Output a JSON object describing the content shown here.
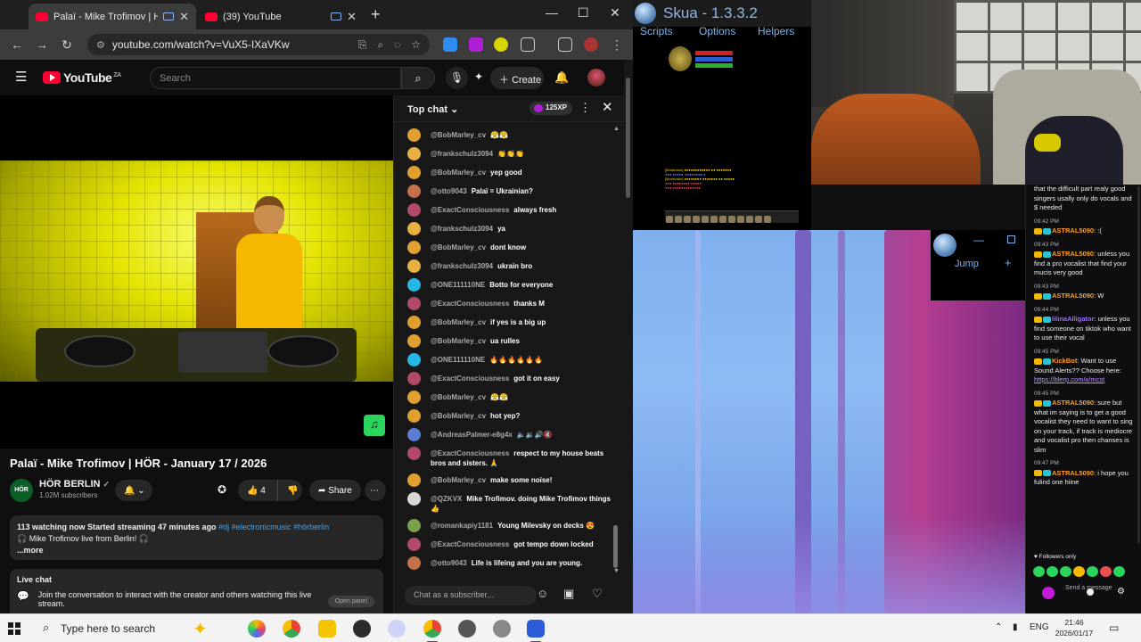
{
  "browser": {
    "tabs": [
      {
        "title": "Palaï - Mike Trofimov | HÖR",
        "active": true
      },
      {
        "title": "(39) YouTube",
        "active": false
      }
    ],
    "url": "youtube.com/watch?v=VuX5-IXaVKw"
  },
  "youtube": {
    "logo_text": "YouTube",
    "country": "ZA",
    "search_placeholder": "Search",
    "create_label": "Create",
    "video_title": "Palaï - Mike Trofimov | HÖR - January 17 / 2026",
    "channel": {
      "avatar_text": "HÖR",
      "name": "HÖR BERLIN",
      "verified": "✓",
      "subscribers": "1.02M subscribers"
    },
    "like_count": "4",
    "share_label": "Share",
    "description": {
      "stats": "113 watching now  Started streaming 47 minutes ago",
      "tags": "#dj #electronicmusic #hörberlin",
      "line2": "🎧 Mike Trofimov live from Berlin! 🎧",
      "more": "...more"
    },
    "live_chat_box": {
      "title": "Live chat",
      "text": "Join the conversation to interact with the creator and others watching this live stream.",
      "button": "Open panel"
    }
  },
  "chat": {
    "header": "Top chat",
    "xp": "125XP",
    "input_placeholder": "Chat as a subscriber...",
    "messages": [
      {
        "author": "@BobMarley_cv",
        "text": "😤😤",
        "color": "#e0a030"
      },
      {
        "author": "@frankschulz3094",
        "text": "👏👏👏",
        "color": "#e8b040"
      },
      {
        "author": "@BobMarley_cv",
        "text": "yep good",
        "color": "#e0a030"
      },
      {
        "author": "@otto9043",
        "text": "Palaï = Ukrainian?",
        "color": "#c4704a"
      },
      {
        "author": "@ExactConsciousness",
        "text": "always fresh",
        "color": "#b34a6a"
      },
      {
        "author": "@frankschulz3094",
        "text": "ya",
        "color": "#e8b040"
      },
      {
        "author": "@BobMarley_cv",
        "text": "dont know",
        "color": "#e0a030"
      },
      {
        "author": "@frankschulz3094",
        "text": "ukrain bro",
        "color": "#e8b040"
      },
      {
        "author": "@ONE111110NE",
        "text": "Botto for everyone",
        "color": "#25b8e6"
      },
      {
        "author": "@ExactConsciousness",
        "text": "thanks M",
        "color": "#b34a6a"
      },
      {
        "author": "@BobMarley_cv",
        "text": "if yes is a big up",
        "color": "#e0a030"
      },
      {
        "author": "@BobMarley_cv",
        "text": "ua rulles",
        "color": "#e0a030"
      },
      {
        "author": "@ONE111110NE",
        "text": "🔥🔥🔥🔥🔥🔥",
        "color": "#25b8e6"
      },
      {
        "author": "@ExactConsciousness",
        "text": "got it on easy",
        "color": "#b34a6a"
      },
      {
        "author": "@BobMarley_cv",
        "text": "😤😤",
        "color": "#e0a030"
      },
      {
        "author": "@BobMarley_cv",
        "text": "hot yep?",
        "color": "#e0a030"
      },
      {
        "author": "@AndreasPalmer-e8g4x",
        "text": "🔈🔉🔊🔇",
        "color": "#5b7fd6"
      },
      {
        "author": "@ExactConsciousness",
        "text": "respect to my house beats bros and sisters. 🙏",
        "color": "#b34a6a"
      },
      {
        "author": "@BobMarley_cv",
        "text": "make some noise!",
        "color": "#e0a030"
      },
      {
        "author": "@QZKVX",
        "text": "Mike Trofimov. doing Mike Trofimov things 👍",
        "color": "#d8d8d8"
      },
      {
        "author": "@romankapiy1181",
        "text": "Young Milevsky on decks 😍",
        "color": "#7aa04a"
      },
      {
        "author": "@ExactConsciousness",
        "text": "got tempo down locked",
        "color": "#b34a6a"
      },
      {
        "author": "@otto9043",
        "text": "Life is lifeing and you are young.",
        "color": "#c4704a"
      }
    ]
  },
  "skua": {
    "title": "Skua - 1.3.3.2",
    "menu": [
      "Scripts",
      "Options",
      "Helpers"
    ],
    "jump_label": "Jump"
  },
  "twitch": {
    "messages": [
      {
        "time": "",
        "user": "",
        "user_color": "#efeff1",
        "text": "that the difficult part realy good singers usally only do vocals and $ needed"
      },
      {
        "time": "09:42 PM",
        "user": "ASTRAL5090",
        "user_color": "#ff9e1f",
        "text": ":("
      },
      {
        "time": "09:43 PM",
        "user": "ASTRAL5090",
        "user_color": "#ff9e1f",
        "text": "unless you find a pro vocalist that find your mucis very good"
      },
      {
        "time": "09:43 PM",
        "user": "ASTRAL5090",
        "user_color": "#ff9e1f",
        "text": "W"
      },
      {
        "time": "09:44 PM",
        "user": "lilinaAlligator",
        "user_color": "#9c6bff",
        "text": "unless you find someone on tiktok who want to use their vocal"
      },
      {
        "time": "09:45 PM",
        "user": "KickBot",
        "user_color": "#ff9e1f",
        "text": "Want to use Sound Alerts?? Choose here:",
        "link": "https://blerp.com/x/mcst"
      },
      {
        "time": "09:45 PM",
        "user": "ASTRAL5090",
        "user_color": "#ff9e1f",
        "text": "sure but what im saying is to get a good vocalist they need to want to sing on your track, if track is mediocre and vocalist pro then chanses is slim"
      },
      {
        "time": "09:47 PM",
        "user": "ASTRAL5090",
        "user_color": "#ff9e1f",
        "text": "i hope you fulind one hiine"
      }
    ],
    "followers_only": "Followers only",
    "send_placeholder": "Send a message"
  },
  "taskbar": {
    "search_placeholder": "Type here to search",
    "lang": "ENG",
    "time": "21:46",
    "date": "2026/01/17"
  }
}
